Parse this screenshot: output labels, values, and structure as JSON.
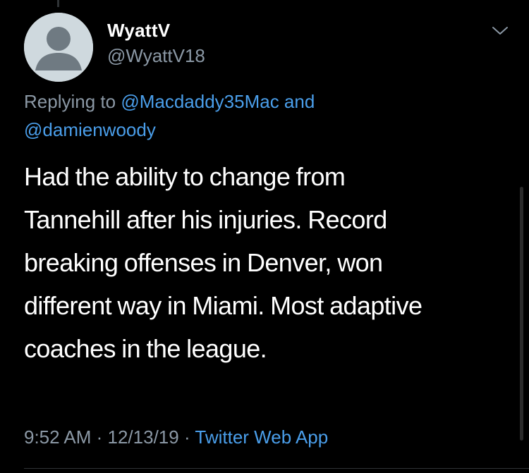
{
  "author": {
    "display_name": "WyattV",
    "handle": "@WyattV18"
  },
  "reply_context": {
    "prefix": "Replying to ",
    "mention_1": "@Macdaddy35Mac",
    "conjunction": " and",
    "mention_2": "@damienwoody"
  },
  "tweet": {
    "lines": [
      "Had the ability to change from",
      "Tannehill after his injuries.  Record",
      "breaking offenses in Denver, won",
      "different way in Miami. Most adaptive",
      "coaches in the league."
    ]
  },
  "meta": {
    "time": "9:52 AM",
    "separator": " · ",
    "date": "12/13/19",
    "separator_2": " · ",
    "source": "Twitter Web App"
  },
  "icons": {
    "avatar": "default-avatar-icon",
    "caret": "chevron-down-icon"
  },
  "colors": {
    "background": "#000000",
    "link": "#4a9eea",
    "secondary_text": "#8b98a5"
  }
}
